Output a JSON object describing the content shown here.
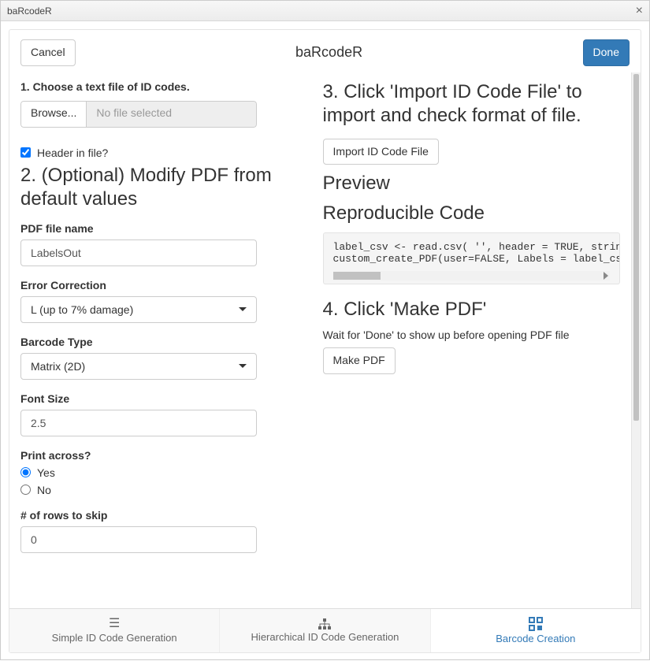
{
  "window": {
    "title": "baRcodeR"
  },
  "header": {
    "cancel": "Cancel",
    "title": "baRcodeR",
    "done": "Done"
  },
  "left": {
    "step1": "1. Choose a text file of ID codes.",
    "browse": "Browse...",
    "no_file": "No file selected",
    "header_in_file": "Header in file?",
    "step2": "2. (Optional) Modify PDF from default values",
    "pdf_name_label": "PDF file name",
    "pdf_name_value": "LabelsOut",
    "error_corr_label": "Error Correction",
    "error_corr_value": "L (up to 7% damage)",
    "barcode_type_label": "Barcode Type",
    "barcode_type_value": "Matrix (2D)",
    "font_size_label": "Font Size",
    "font_size_value": "2.5",
    "print_across_label": "Print across?",
    "print_yes": "Yes",
    "print_no": "No",
    "rows_skip_label": "# of rows to skip",
    "rows_skip_value": "0"
  },
  "right": {
    "step3": "3. Click 'Import ID Code File' to import and check format of file.",
    "import_btn": "Import ID Code File",
    "preview": "Preview",
    "repro": "Reproducible Code",
    "code_line1": "label_csv <- read.csv( '', header = TRUE, stringsAs",
    "code_line2": "custom_create_PDF(user=FALSE, Labels = label_csv[,]",
    "step4": "4. Click 'Make PDF'",
    "wait_text": "Wait for 'Done' to show up before opening PDF file",
    "make_pdf": "Make PDF"
  },
  "tabs": {
    "t1": "Simple ID Code Generation",
    "t2": "Hierarchical ID Code Generation",
    "t3": "Barcode Creation"
  }
}
